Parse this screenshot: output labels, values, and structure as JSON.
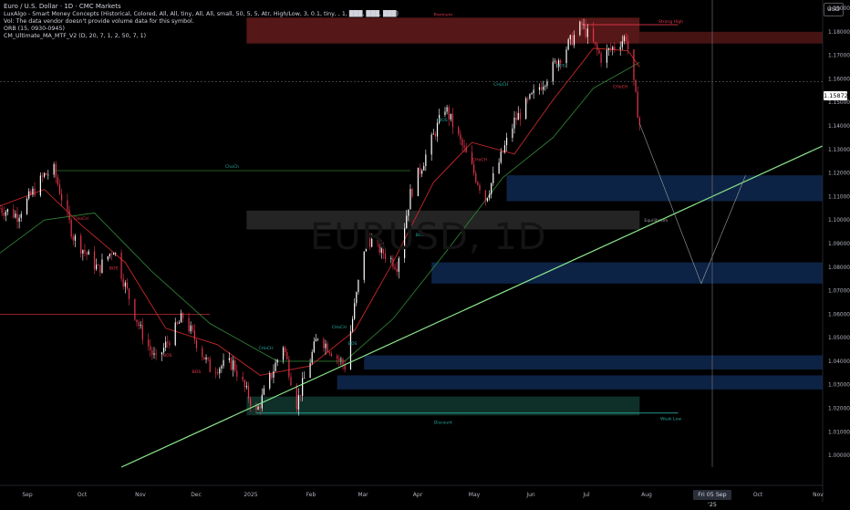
{
  "header": {
    "title": "Euro / U.S. Dollar · 1D · CMC Markets",
    "indicators": [
      "LuxAlgo - Smart Money Concepts (Historical, Colored, All, All, tiny, All, All, small, 50, 5, 5, Atr, High/Low, 3, 0.1, tiny, , 1, ███, ███, ███)",
      "Vol: The data vendor doesn't provide volume data for this symbol.",
      "ORB (15, 0930-0945)",
      "CM_Ultimate_MA_MTF_V2 (D, 20, 7, 1, 2, 50, 7, 1)"
    ]
  },
  "watermark": "EURUSD, 1D",
  "currency": "USD",
  "last_price": "1.15872",
  "crosshair_date": "Fri 05 Sep '25",
  "colors": {
    "bull": "#ffffff",
    "bear": "#e5364b",
    "ma_fast": "#c62828",
    "ma_slow": "#2e7d32",
    "trendline": "#8ae68a",
    "demand_zone": "#0e2549",
    "supply_zone": "#5a1818",
    "discount_zone": "#10332a",
    "equilibrium_zone": "#262626"
  },
  "chart_data": {
    "type": "candlestick",
    "xlabels": [
      "Sep",
      "Oct",
      "Nov",
      "Dec",
      "2025",
      "Feb",
      "Mar",
      "Apr",
      "May",
      "Jun",
      "Jul",
      "Aug",
      "Oct",
      "Nov"
    ],
    "yticks": [
      "1.19000",
      "1.18000",
      "1.17000",
      "1.16000",
      "1.15000",
      "1.14000",
      "1.13000",
      "1.12000",
      "1.11000",
      "1.10000",
      "1.09000",
      "1.08000",
      "1.07000",
      "1.06000",
      "1.05000",
      "1.04000",
      "1.03000",
      "1.02000",
      "1.01000",
      "1.00000"
    ],
    "ylim": [
      0.995,
      1.1935
    ],
    "x_start": "2024-09-02",
    "x_end": "2025-11-03",
    "last_price": 1.15872,
    "labels": {
      "premium": "Premium",
      "discount": "Discount",
      "equilibrium": "Equilibrium",
      "strong_high": "Strong High",
      "weak_low": "Weak Low",
      "choch_major": "ChoCh",
      "choch": "CHoCH",
      "bos": "BOS"
    },
    "ohlc_path": [
      [
        "2024-09-02",
        1.105
      ],
      [
        "2024-09-11",
        1.102
      ],
      [
        "2024-09-25",
        1.119
      ],
      [
        "2024-09-30",
        1.121
      ],
      [
        "2024-10-10",
        1.093
      ],
      [
        "2024-10-23",
        1.079
      ],
      [
        "2024-10-31",
        1.088
      ],
      [
        "2024-11-06",
        1.072
      ],
      [
        "2024-11-14",
        1.053
      ],
      [
        "2024-11-22",
        1.04
      ],
      [
        "2024-12-06",
        1.059
      ],
      [
        "2024-12-20",
        1.037
      ],
      [
        "2025-01-01",
        1.039
      ],
      [
        "2025-01-13",
        1.018
      ],
      [
        "2025-01-27",
        1.047
      ],
      [
        "2025-02-03",
        1.022
      ],
      [
        "2025-02-14",
        1.051
      ],
      [
        "2025-02-28",
        1.038
      ],
      [
        "2025-03-11",
        1.093
      ],
      [
        "2025-03-27",
        1.081
      ],
      [
        "2025-04-03",
        1.111
      ],
      [
        "2025-04-21",
        1.148
      ],
      [
        "2025-05-12",
        1.109
      ],
      [
        "2025-05-27",
        1.142
      ],
      [
        "2025-06-12",
        1.16
      ],
      [
        "2025-07-01",
        1.183
      ],
      [
        "2025-07-11",
        1.169
      ],
      [
        "2025-07-24",
        1.178
      ],
      [
        "2025-07-31",
        1.141
      ]
    ],
    "moving_averages": {
      "fast": [
        [
          "2024-09-02",
          1.106
        ],
        [
          "2024-09-25",
          1.113
        ],
        [
          "2024-10-14",
          1.098
        ],
        [
          "2024-11-06",
          1.082
        ],
        [
          "2024-11-27",
          1.054
        ],
        [
          "2024-12-24",
          1.047
        ],
        [
          "2025-01-15",
          1.034
        ],
        [
          "2025-02-10",
          1.038
        ],
        [
          "2025-03-05",
          1.053
        ],
        [
          "2025-03-25",
          1.082
        ],
        [
          "2025-04-15",
          1.116
        ],
        [
          "2025-05-05",
          1.133
        ],
        [
          "2025-05-27",
          1.128
        ],
        [
          "2025-06-16",
          1.151
        ],
        [
          "2025-07-07",
          1.173
        ],
        [
          "2025-07-25",
          1.172
        ],
        [
          "2025-07-31",
          1.165
        ]
      ],
      "slow": [
        [
          "2024-09-02",
          1.086
        ],
        [
          "2024-09-25",
          1.1
        ],
        [
          "2024-10-21",
          1.103
        ],
        [
          "2024-11-20",
          1.078
        ],
        [
          "2024-12-20",
          1.056
        ],
        [
          "2025-01-24",
          1.04
        ],
        [
          "2025-02-28",
          1.04
        ],
        [
          "2025-03-25",
          1.058
        ],
        [
          "2025-04-21",
          1.086
        ],
        [
          "2025-05-21",
          1.118
        ],
        [
          "2025-06-16",
          1.135
        ],
        [
          "2025-07-07",
          1.156
        ],
        [
          "2025-07-31",
          1.167
        ]
      ]
    },
    "zones": [
      {
        "kind": "premium",
        "from": "2025-01-08",
        "to": "2025-07-31",
        "low": 1.175,
        "high": 1.186
      },
      {
        "kind": "supply",
        "from": "2025-07-31",
        "to": "2025-11-03",
        "low": 1.175,
        "high": 1.18
      },
      {
        "kind": "demand",
        "from": "2025-05-23",
        "to": "2025-11-03",
        "low": 1.108,
        "high": 1.119
      },
      {
        "kind": "equilibrium",
        "from": "2025-01-08",
        "to": "2025-07-31",
        "low": 1.096,
        "high": 1.104
      },
      {
        "kind": "demand",
        "from": "2025-04-14",
        "to": "2025-11-03",
        "low": 1.073,
        "high": 1.082
      },
      {
        "kind": "demand",
        "from": "2025-03-10",
        "to": "2025-11-03",
        "low": 1.0365,
        "high": 1.0425
      },
      {
        "kind": "demand",
        "from": "2025-02-24",
        "to": "2025-11-03",
        "low": 1.028,
        "high": 1.034
      },
      {
        "kind": "discount",
        "from": "2025-01-08",
        "to": "2025-07-31",
        "low": 1.017,
        "high": 1.025
      }
    ],
    "trendline": [
      [
        "2024-11-04",
        0.995
      ],
      [
        "2025-11-03",
        1.1315
      ]
    ],
    "projection": [
      [
        "2025-07-31",
        1.141
      ],
      [
        "2025-09-01",
        1.073
      ],
      [
        "2025-09-24",
        1.119
      ]
    ],
    "horizontal_lines": [
      {
        "kind": "choch_major",
        "from": "2024-09-30",
        "to": "2025-04-03",
        "y": 1.121
      },
      {
        "kind": "red_level",
        "from": "2024-09-02",
        "to": "2024-12-20",
        "y": 1.06
      },
      {
        "kind": "strong_high",
        "from": "2025-07-01",
        "to": "2025-08-20",
        "y": 1.183
      },
      {
        "kind": "weak_low",
        "from": "2025-01-13",
        "to": "2025-08-20",
        "y": 1.018
      }
    ]
  }
}
